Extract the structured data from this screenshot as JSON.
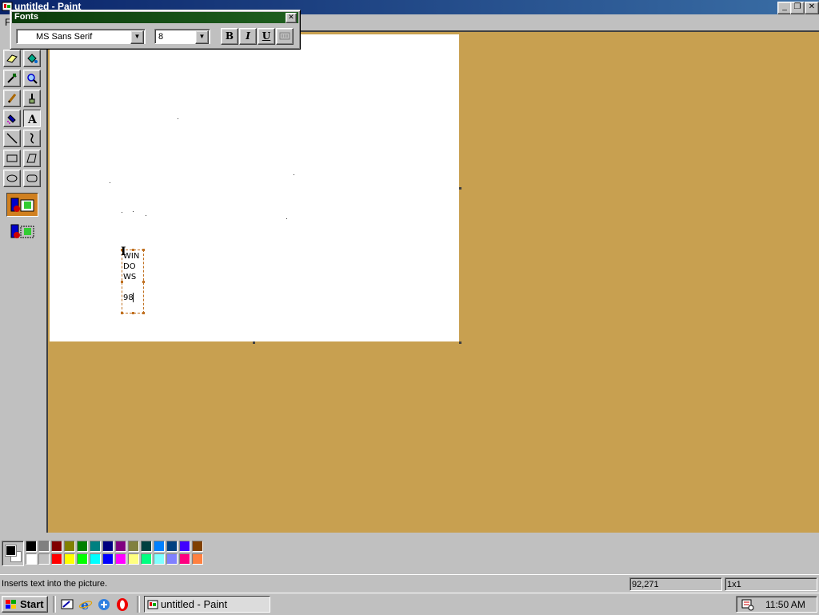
{
  "app": {
    "title": "untitled - Paint",
    "menu_file": "F"
  },
  "fonts_toolbar": {
    "title": "Fonts",
    "font_name": "MS Sans Serif",
    "font_size": "8",
    "bold_label": "B",
    "italic_label": "I",
    "underline_label": "U"
  },
  "canvas_text": {
    "lines": [
      "WIN",
      "DO",
      "WS",
      "98"
    ]
  },
  "palette": {
    "row1": [
      "#000000",
      "#808080",
      "#800000",
      "#808000",
      "#008000",
      "#008080",
      "#000080",
      "#800080",
      "#808040",
      "#004040",
      "#0080ff",
      "#004080",
      "#4000ff",
      "#804000"
    ],
    "row2": [
      "#ffffff",
      "#c0c0c0",
      "#ff0000",
      "#ffff00",
      "#00ff00",
      "#00ffff",
      "#0000ff",
      "#ff00ff",
      "#ffff80",
      "#00ff80",
      "#80ffff",
      "#8080ff",
      "#ff0080",
      "#ff8040"
    ],
    "foreground": "#000000",
    "background": "#ffffff"
  },
  "status": {
    "help_text": "Inserts text into the picture.",
    "coordinates": "92,271",
    "selection_size": "1x1"
  },
  "taskbar": {
    "start_label": "Start",
    "task_label": "untitled - Paint",
    "clock": "11:50 AM"
  },
  "colors": {
    "workspace": "#c8a050",
    "titlebar": "#0a246a",
    "fonts_titlebar": "#0b3b0b"
  }
}
